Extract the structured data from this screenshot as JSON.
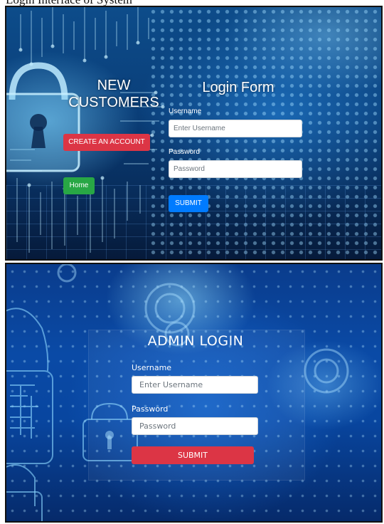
{
  "caption": {
    "text": "Login Interface of System"
  },
  "user_panel": {
    "new_customers_title": "NEW CUSTOMERS",
    "create_account_label": "CREATE AN ACCOUNT",
    "home_label": "Home",
    "form_title": "Login Form",
    "username_label": "Username",
    "username_placeholder": "Enter Username",
    "password_label": "Password",
    "password_placeholder": "Password",
    "submit_label": "SUBMIT",
    "colors": {
      "create_button": "#dc3545",
      "home_button": "#28a745",
      "submit_button": "#007bff"
    },
    "icons": [
      "padlock-icon"
    ]
  },
  "admin_panel": {
    "title": "ADMIN LOGIN",
    "username_label": "Username",
    "username_placeholder": "Enter Username",
    "password_label": "Password",
    "password_placeholder": "Password",
    "submit_label": "SUBMIT",
    "colors": {
      "submit_button": "#dc3545"
    }
  }
}
